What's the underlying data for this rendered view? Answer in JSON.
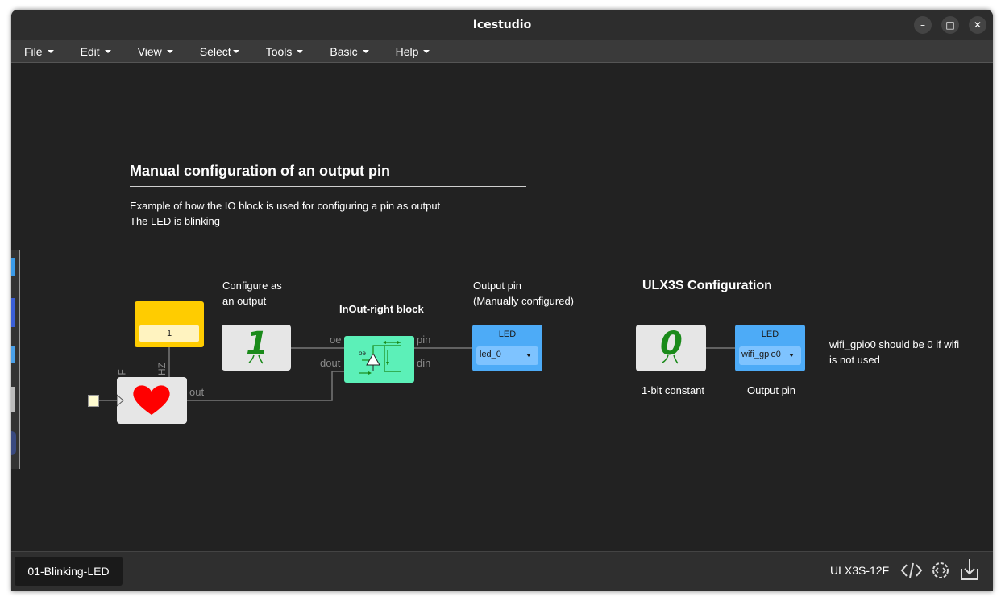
{
  "window": {
    "title": "Icestudio"
  },
  "menu": [
    {
      "label": "File"
    },
    {
      "label": "Edit"
    },
    {
      "label": "View"
    },
    {
      "label": "Select"
    },
    {
      "label": "Tools"
    },
    {
      "label": "Basic"
    },
    {
      "label": "Help"
    }
  ],
  "canvas": {
    "heading": "Manual configuration of an output pin",
    "description_line1": "Example of how the IO block is used for configuring a pin as output",
    "description_line2": "The LED is blinking",
    "configure_label_line1": "Configure as",
    "configure_label_line2": "an output",
    "inout_title": "InOut-right block",
    "output_pin_label_line1": "Output pin",
    "output_pin_label_line2": "(Manually configured)",
    "ulx3s_heading": "ULX3S Configuration",
    "wifi_note_line1": "wifi_gpio0 should be 0 if wifi",
    "wifi_note_line2": "is not used",
    "constant_label": "1-bit constant",
    "output_pin_label": "Output pin",
    "param_value": "1",
    "heart_port_f": "F",
    "heart_port_hz": "HZ",
    "heart_port_out": "out",
    "const_one_value": "1",
    "const_zero_value": "0",
    "inout_port_oe": "oe",
    "inout_port_dout": "dout",
    "inout_port_pin": "pin",
    "inout_port_din": "din",
    "inout_icon_oe": "oe",
    "led_block_1": {
      "title": "LED",
      "selected": "led_0"
    },
    "led_block_2": {
      "title": "LED",
      "selected": "wifi_gpio0"
    }
  },
  "bottom": {
    "tab_label": "01-Blinking-LED",
    "board_name": "ULX3S-12F",
    "icons": [
      "code-icon",
      "settings-code-icon",
      "download-icon"
    ]
  },
  "colors": {
    "background": "#222222",
    "param_block": "#ffcc00",
    "inout_block": "#5cf0b8",
    "led_block": "#4dabf7",
    "heart": "#ff0000",
    "constant_green": "#1a8a1a"
  }
}
